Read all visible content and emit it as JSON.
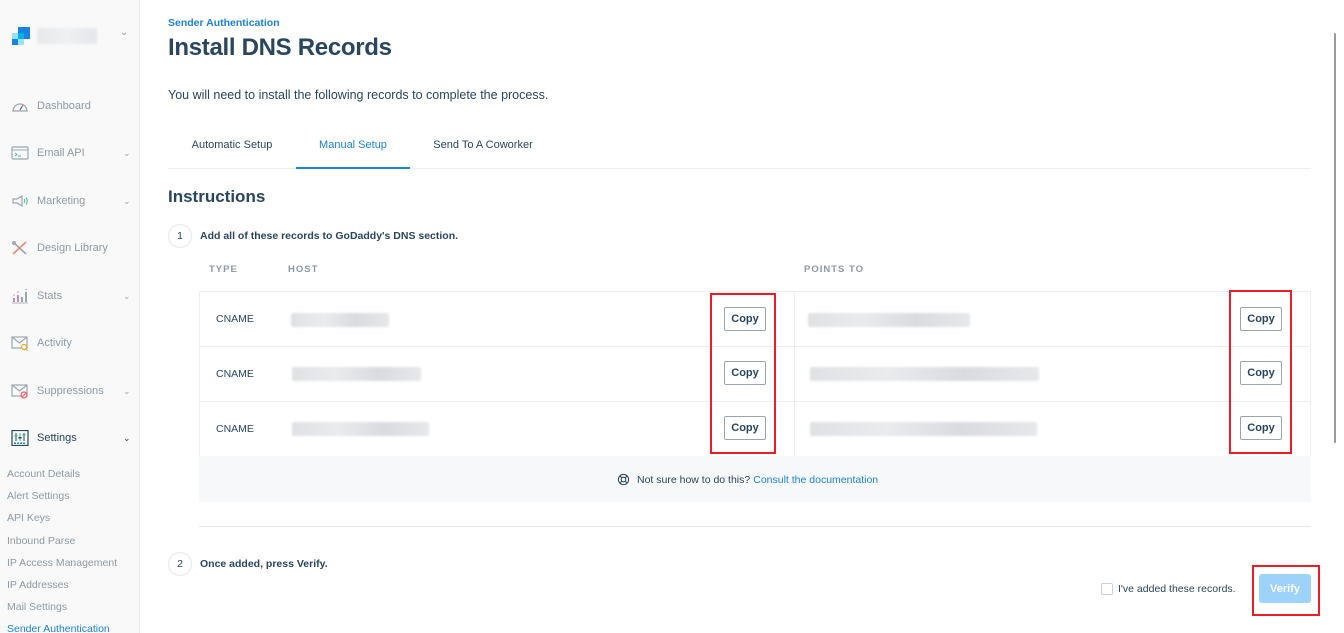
{
  "sidebar": {
    "account_name": "",
    "items": [
      {
        "label": "Dashboard",
        "icon": "dashboard-gauge-icon",
        "has_chevron": false
      },
      {
        "label": "Email API",
        "icon": "email-api-terminal-icon",
        "has_chevron": true
      },
      {
        "label": "Marketing",
        "icon": "megaphone-icon",
        "has_chevron": true
      },
      {
        "label": "Design Library",
        "icon": "design-tools-icon",
        "has_chevron": false
      },
      {
        "label": "Stats",
        "icon": "bar-stats-icon",
        "has_chevron": true
      },
      {
        "label": "Activity",
        "icon": "envelope-search-icon",
        "has_chevron": false
      },
      {
        "label": "Suppressions",
        "icon": "envelope-blocked-icon",
        "has_chevron": true
      },
      {
        "label": "Settings",
        "icon": "settings-sliders-icon",
        "has_chevron": true
      }
    ],
    "chevron": "⌄",
    "settings_submenu": [
      "Account Details",
      "Alert Settings",
      "API Keys",
      "Inbound Parse",
      "IP Access Management",
      "IP Addresses",
      "Mail Settings",
      "Sender Authentication"
    ],
    "active_submenu": "Sender Authentication"
  },
  "header": {
    "breadcrumb": "Sender Authentication",
    "title": "Install DNS Records",
    "intro": "You will need to install the following records to complete the process."
  },
  "tabs": [
    {
      "label": "Automatic Setup",
      "active": false
    },
    {
      "label": "Manual Setup",
      "active": true
    },
    {
      "label": "Send To A Coworker",
      "active": false
    }
  ],
  "instructions": {
    "heading": "Instructions",
    "step1": {
      "number": "1",
      "text": "Add all of these records to GoDaddy's DNS section."
    },
    "step2": {
      "number": "2",
      "text": "Once added, press Verify."
    }
  },
  "table": {
    "headers": {
      "type": "TYPE",
      "host": "HOST",
      "points_to": "POINTS TO"
    },
    "rows": [
      {
        "type": "CNAME",
        "host": "[redacted]",
        "points_to": "[redacted]"
      },
      {
        "type": "CNAME",
        "host": "[redacted]",
        "points_to": "[redacted]"
      },
      {
        "type": "CNAME",
        "host": "[redacted]",
        "points_to": "[redacted]"
      }
    ],
    "copy_label": "Copy"
  },
  "help": {
    "text": "Not sure how to do this?",
    "link": "Consult the documentation"
  },
  "verify": {
    "checkbox_label": "I've added these records.",
    "checked": false,
    "button_label": "Verify",
    "button_enabled": false
  },
  "colors": {
    "accent": "#1a82e2",
    "text": "#294661",
    "muted": "#8d9aa7",
    "verify_disabled": "#9dd2fb",
    "highlight": "#ee1c24"
  }
}
